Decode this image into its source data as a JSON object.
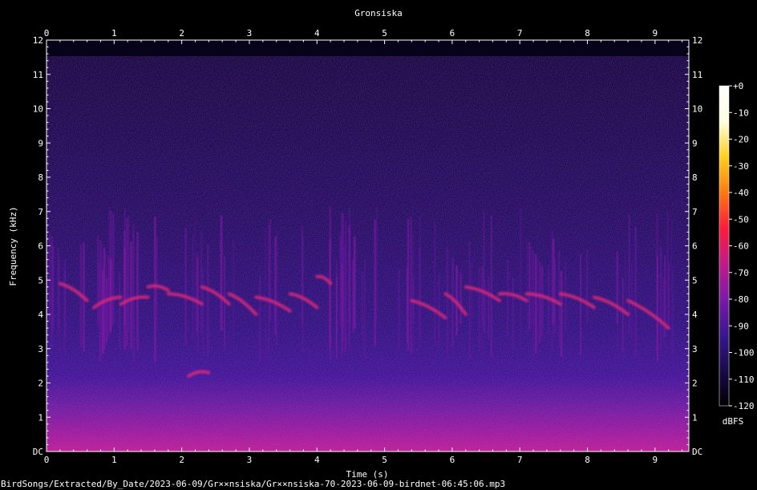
{
  "chart_data": {
    "type": "heatmap",
    "title": "Gronsiska",
    "xlabel": "Time (s)",
    "ylabel": "Frequency (kHz)",
    "xlim": [
      0,
      9.5
    ],
    "ylim": [
      0,
      12
    ],
    "x_ticks": [
      "0",
      "1",
      "2",
      "3",
      "4",
      "5",
      "6",
      "7",
      "8",
      "9"
    ],
    "y_ticks": [
      "DC",
      "1",
      "2",
      "3",
      "4",
      "5",
      "6",
      "7",
      "8",
      "9",
      "10",
      "11",
      "12"
    ],
    "colorbar": {
      "label": "dBFS",
      "range": [
        -120,
        0
      ],
      "ticks": [
        "+0",
        "-10",
        "-20",
        "-30",
        "-40",
        "-50",
        "-60",
        "-70",
        "-80",
        "-90",
        "-100",
        "-110",
        "-120"
      ],
      "colors": [
        "#000000",
        "#1a0a4a",
        "#3a1690",
        "#7a1aa8",
        "#c21a8a",
        "#ff1a3a",
        "#ff7a10",
        "#ffd020",
        "#ffffe0",
        "#ffffff"
      ]
    },
    "signal_segments": [
      {
        "t0": 0.2,
        "t1": 0.6,
        "f_start": 4.9,
        "f_end": 4.4
      },
      {
        "t0": 0.7,
        "t1": 1.1,
        "f_start": 4.2,
        "f_end": 4.5
      },
      {
        "t0": 1.1,
        "t1": 1.5,
        "f_start": 4.3,
        "f_end": 4.5
      },
      {
        "t0": 1.5,
        "t1": 1.8,
        "f_start": 4.8,
        "f_end": 4.7
      },
      {
        "t0": 1.8,
        "t1": 2.3,
        "f_start": 4.6,
        "f_end": 4.3
      },
      {
        "t0": 2.3,
        "t1": 2.7,
        "f_start": 4.8,
        "f_end": 4.3
      },
      {
        "t0": 2.7,
        "t1": 3.1,
        "f_start": 4.6,
        "f_end": 4.0
      },
      {
        "t0": 3.1,
        "t1": 3.6,
        "f_start": 4.5,
        "f_end": 4.1
      },
      {
        "t0": 3.6,
        "t1": 4.0,
        "f_start": 4.6,
        "f_end": 4.2
      },
      {
        "t0": 4.0,
        "t1": 4.2,
        "f_start": 5.1,
        "f_end": 4.9
      },
      {
        "t0": 5.4,
        "t1": 5.9,
        "f_start": 4.4,
        "f_end": 3.9
      },
      {
        "t0": 5.9,
        "t1": 6.2,
        "f_start": 4.6,
        "f_end": 4.0
      },
      {
        "t0": 6.2,
        "t1": 6.7,
        "f_start": 4.8,
        "f_end": 4.4
      },
      {
        "t0": 6.7,
        "t1": 7.1,
        "f_start": 4.6,
        "f_end": 4.4
      },
      {
        "t0": 7.1,
        "t1": 7.6,
        "f_start": 4.6,
        "f_end": 4.3
      },
      {
        "t0": 7.6,
        "t1": 8.1,
        "f_start": 4.6,
        "f_end": 4.2
      },
      {
        "t0": 8.1,
        "t1": 8.6,
        "f_start": 4.5,
        "f_end": 4.0
      },
      {
        "t0": 8.6,
        "t1": 9.2,
        "f_start": 4.4,
        "f_end": 3.6
      },
      {
        "t0": 2.1,
        "t1": 2.4,
        "f_start": 2.2,
        "f_end": 2.3
      }
    ]
  },
  "footer": {
    "file_path": "BirdSongs/Extracted/By_Date/2023-06-09/Gr××nsiska/Gr××nsiska-70-2023-06-09-birdnet-06:45:06.mp3"
  }
}
